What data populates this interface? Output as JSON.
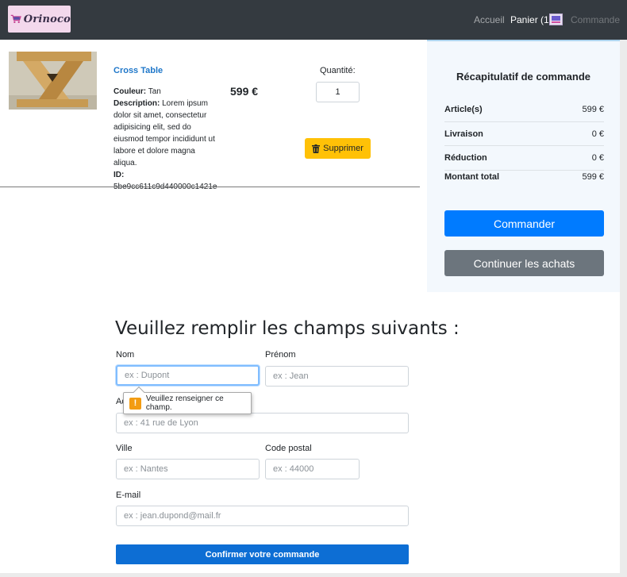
{
  "navbar": {
    "logo_text": "Orinoco",
    "links": {
      "accueil": "Accueil",
      "panier": "Panier (1)",
      "commande": "Commande"
    }
  },
  "product": {
    "name": "Cross Table",
    "color_label": "Couleur:",
    "color_value": "Tan",
    "desc_label": "Description:",
    "desc_value": "Lorem ipsum dolor sit amet, consectetur adipisicing elit, sed do eiusmod tempor incididunt ut labore et dolore magna aliqua.",
    "id_label": "ID:",
    "id_value": "5be9cc611c9d440000c1421e",
    "price": "599 €",
    "qty_label": "Quantité:",
    "qty_value": "1",
    "delete_label": "Supprimer"
  },
  "summary": {
    "title": "Récapitulatif de commande",
    "rows": [
      {
        "label": "Article(s)",
        "value": "599 €"
      },
      {
        "label": "Livraison",
        "value": "0 €"
      },
      {
        "label": "Réduction",
        "value": "0 €"
      },
      {
        "label": "Montant total",
        "value": "599 €"
      }
    ],
    "btn_commander": "Commander",
    "btn_continuer": "Continuer les achats"
  },
  "form": {
    "title": "Veuillez remplir les champs suivants :",
    "nom_label": "Nom",
    "nom_placeholder": "ex : Dupont",
    "prenom_label": "Prénom",
    "prenom_placeholder": "ex : Jean",
    "adresse_label": "Adresse",
    "adresse_placeholder": "ex : 41 rue de Lyon",
    "ville_label": "Ville",
    "ville_placeholder": "ex : Nantes",
    "cp_label": "Code postal",
    "cp_placeholder": "ex : 44000",
    "email_label": "E-mail",
    "email_placeholder": "ex : jean.dupond@mail.fr",
    "confirm_label": "Confirmer votre commande"
  },
  "validation_tooltip": {
    "message": "Veuillez renseigner ce champ.",
    "icon": "warning-icon"
  },
  "colors": {
    "navbar_bg": "#343a40",
    "primary": "#007bff",
    "secondary": "#6c757d",
    "warning": "#ffc107",
    "link": "#1f77c9",
    "summary_bg": "#f3f8fd"
  }
}
